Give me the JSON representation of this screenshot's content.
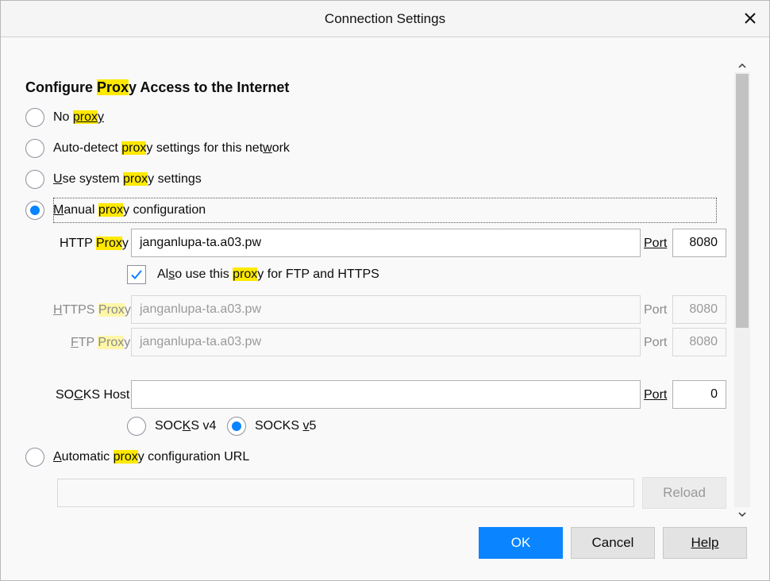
{
  "dialog": {
    "title": "Connection Settings"
  },
  "heading": {
    "pre": "Configure ",
    "hl": "Prox",
    "post": "y Access to the Internet"
  },
  "radios": {
    "no_proxy": {
      "pre": "No ",
      "hl": "prox",
      "post": "y"
    },
    "auto_detect": {
      "pre": "Auto-detect ",
      "hl": "prox",
      "post_a": "y settings for this net",
      "ul": "w",
      "post_b": "ork"
    },
    "system": {
      "ul": "U",
      "pre": "se system ",
      "hl": "prox",
      "post": "y settings"
    },
    "manual": {
      "ul": "M",
      "pre": "anual ",
      "hl": "prox",
      "post": "y configuration",
      "checked": true
    },
    "auto_url": {
      "ul": "A",
      "pre": "utomatic ",
      "hl": "prox",
      "post": "y configuration URL"
    }
  },
  "http": {
    "label_pre": "HTTP ",
    "label_hl": "Prox",
    "label_post": "y",
    "value": "janganlupa-ta.a03.pw",
    "port_label": "Port",
    "port": "8080"
  },
  "also_use": {
    "ul_pre": "Al",
    "ul": "s",
    "pre": "o use this ",
    "hl": "prox",
    "post": "y for FTP and HTTPS",
    "checked": true
  },
  "https": {
    "label_ul": "H",
    "label_pre": "TTPS ",
    "label_hl": "Prox",
    "label_post": "y",
    "value": "janganlupa-ta.a03.pw",
    "port_label": "Port",
    "port": "8080"
  },
  "ftp": {
    "label_ul": "F",
    "label_pre": "TP ",
    "label_hl": "Prox",
    "label_post": "y",
    "value": "janganlupa-ta.a03.pw",
    "port_label": "Port",
    "port": "8080"
  },
  "socks": {
    "label_pre": "SO",
    "label_ul": "C",
    "label_post": "KS Host",
    "value": "",
    "port_label": "Port",
    "port": "0",
    "v4_pre": "SOC",
    "v4_ul": "K",
    "v4_post": "S v4",
    "v5_pre": "SOCKS ",
    "v5_ul": "v",
    "v5_post": "5",
    "selected": "v5"
  },
  "auto_url_field": {
    "value": "",
    "reload_label": "Reload"
  },
  "buttons": {
    "ok": "OK",
    "cancel": "Cancel",
    "help": "Help"
  },
  "colors": {
    "accent": "#0a84ff",
    "highlight": "#ffe900"
  },
  "icons": {
    "close": "close-icon",
    "check": "checkmark-icon",
    "up": "chevron-up-icon",
    "down": "chevron-down-icon"
  }
}
